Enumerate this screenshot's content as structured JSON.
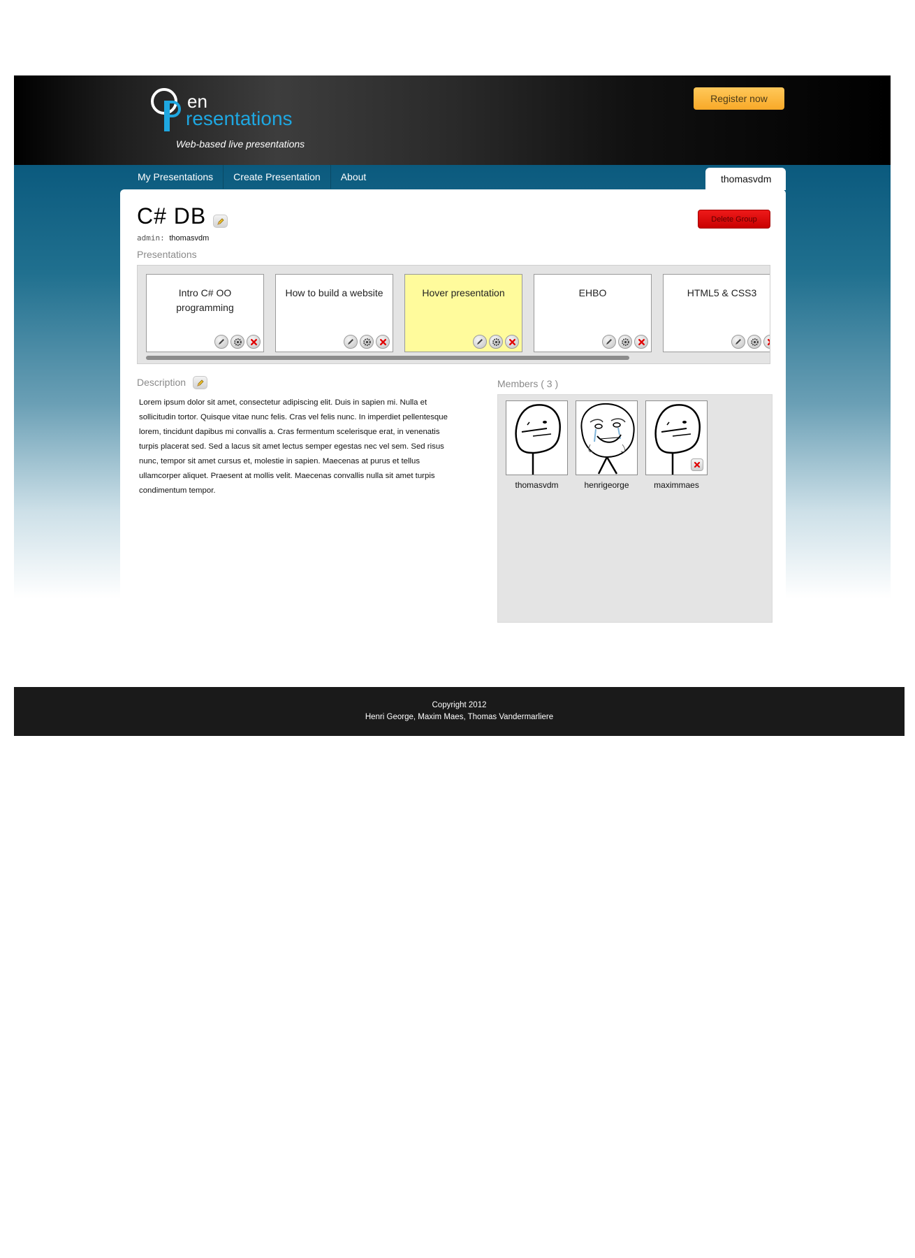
{
  "header": {
    "logo": {
      "line1": "en",
      "line2": "resentations",
      "tagline": "Web-based live presentations"
    },
    "register_label": "Register now"
  },
  "nav": {
    "items": [
      {
        "label": "My Presentations"
      },
      {
        "label": "Create Presentation"
      },
      {
        "label": "About"
      }
    ],
    "user": "thomasvdm"
  },
  "group": {
    "title": "C# DB",
    "admin_label": "admin:",
    "admin_name": "thomasvdm",
    "delete_label": "Delete Group"
  },
  "presentations": {
    "heading": "Presentations",
    "items": [
      {
        "title": "Intro C# OO programming",
        "highlighted": false
      },
      {
        "title": "How to build a website",
        "highlighted": false
      },
      {
        "title": "Hover presentation",
        "highlighted": true
      },
      {
        "title": "EHBO",
        "highlighted": false
      },
      {
        "title": "HTML5 & CSS3",
        "highlighted": false
      }
    ]
  },
  "description": {
    "heading": "Description",
    "text": "Lorem ipsum dolor sit amet, consectetur adipiscing elit. Duis in sapien mi. Nulla et sollicitudin tortor. Quisque vitae nunc felis. Cras vel felis nunc. In imperdiet pellentesque lorem, tincidunt dapibus mi convallis a. Cras fermentum scelerisque erat, in venenatis turpis placerat sed. Sed a lacus sit amet lectus semper egestas nec vel sem. Sed risus nunc, tempor sit amet cursus et, molestie in sapien. Maecenas at purus et tellus ullamcorper aliquet. Praesent at mollis velit. Maecenas convallis nulla sit amet turpis condimentum tempor."
  },
  "members": {
    "heading": "Members ( 3 )",
    "items": [
      {
        "name": "thomasvdm",
        "avatar": "poker-face-avatar"
      },
      {
        "name": "henrigeorge",
        "avatar": "forever-alone-avatar"
      },
      {
        "name": "maximmaes",
        "avatar": "poker-face-avatar"
      }
    ]
  },
  "footer": {
    "line1": "Copyright 2012",
    "line2": "Henri George, Maxim Maes, Thomas Vandermarliere"
  },
  "colors": {
    "accent_blue": "#1ea7e1",
    "band_blue": "#0b5a7e",
    "register_orange": "#f8a928",
    "delete_red": "#d40000",
    "hover_yellow": "#fffb9c"
  }
}
